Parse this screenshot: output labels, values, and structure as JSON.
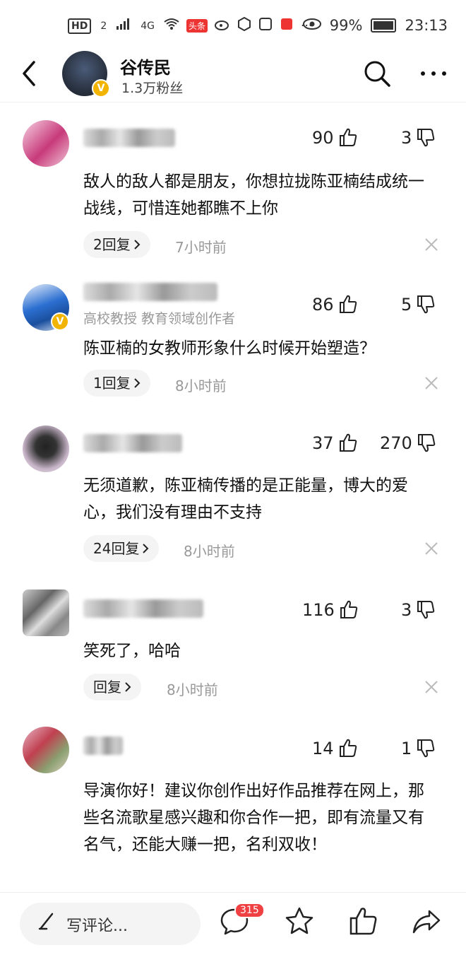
{
  "status_bar": {
    "left_items": [
      "HD",
      "2",
      "4G",
      "头条"
    ],
    "more": "···",
    "battery": "99%",
    "time": "23:13"
  },
  "header": {
    "name": "谷传民",
    "fans": "1.3万粉丝",
    "verified_badge": "V",
    "icons": [
      "back-arrow-icon",
      "search-icon",
      "more-icon"
    ]
  },
  "comments": [
    {
      "likes": "90",
      "dislikes": "3",
      "text": "敌人的敌人都是朋友，你想拉拢陈亚楠结成统一战线，可惜连她都瞧不上你",
      "reply_label": "2回复",
      "time": "7小时前"
    },
    {
      "likes": "86",
      "dislikes": "5",
      "subtitle": "高校教授 教育领域创作者",
      "text": "陈亚楠的女教师形象什么时候开始塑造？",
      "reply_label": "1回复",
      "time": "8小时前"
    },
    {
      "likes": "37",
      "dislikes": "270",
      "text": "无须道歉，陈亚楠传播的是正能量，博大的爱心，我们没有理由不支持",
      "reply_label": "24回复",
      "time": "8小时前"
    },
    {
      "likes": "116",
      "dislikes": "3",
      "text": "笑死了，哈哈",
      "reply_label": "回复",
      "time": "8小时前"
    },
    {
      "likes": "14",
      "dislikes": "1",
      "text": "导演你好！建议你创作出好作品推荐在网上，那些名流歌星感兴趣和你合作一把，即有流量又有名气，还能大赚一把，名利双收！"
    }
  ],
  "bottom_bar": {
    "write_placeholder": "写评论...",
    "comment_count": "315",
    "icons": [
      "pen-icon",
      "comment-icon",
      "star-icon",
      "like-icon",
      "share-icon"
    ]
  },
  "colors": {
    "accent_red": "#f04142",
    "verified": "#f3b400",
    "muted": "#999999"
  }
}
